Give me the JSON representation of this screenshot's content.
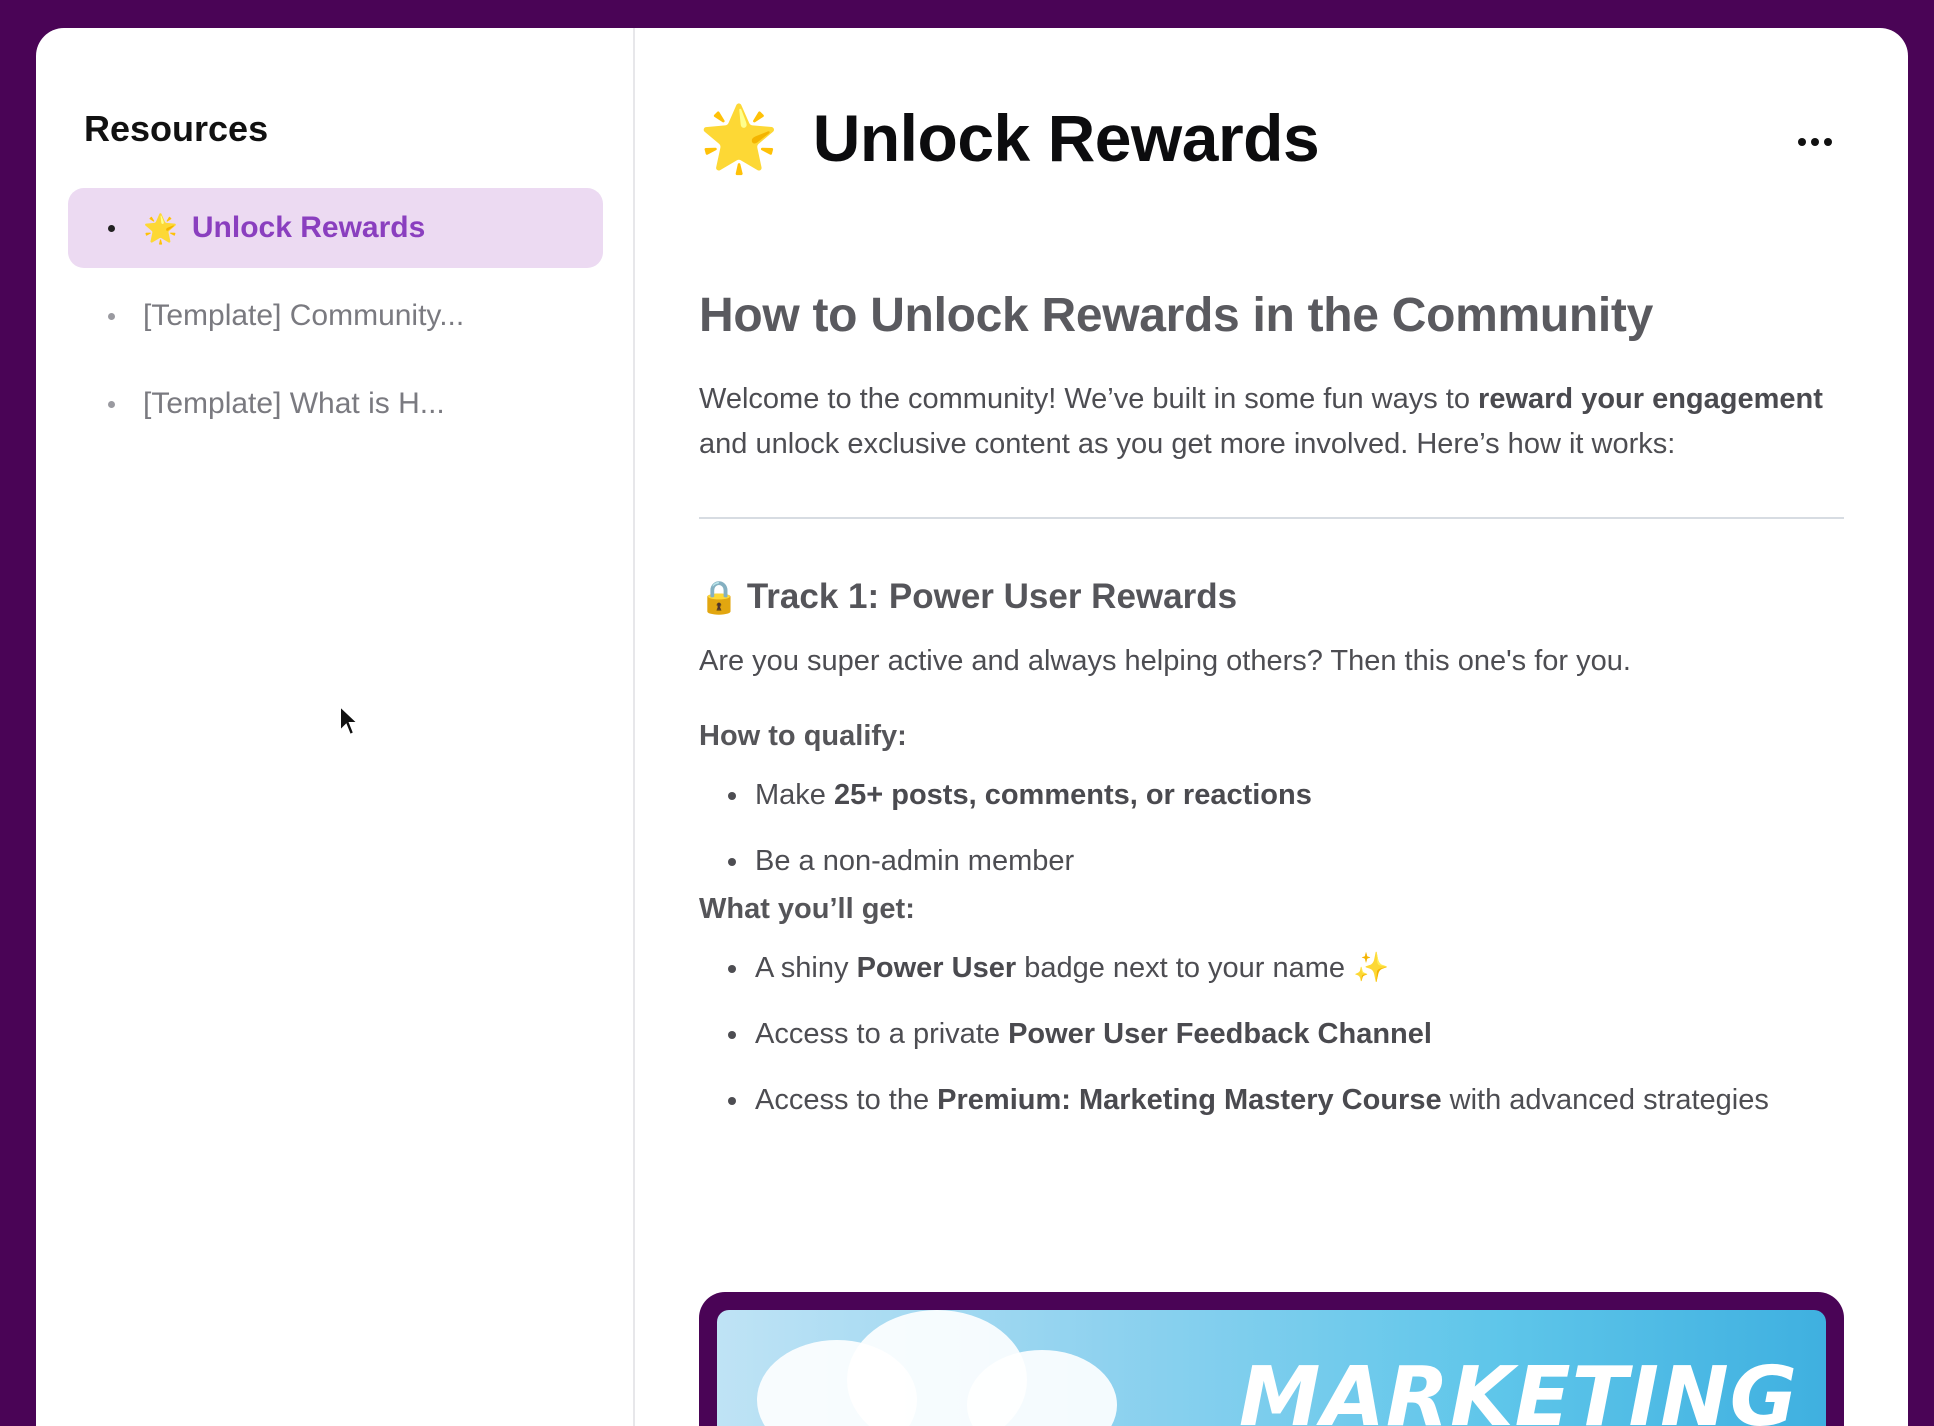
{
  "sidebar": {
    "title": "Resources",
    "items": [
      {
        "emoji": "🌟",
        "label": "Unlock Rewards",
        "active": true
      },
      {
        "emoji": "",
        "label": "[Template] Community...",
        "active": false
      },
      {
        "emoji": "",
        "label": "[Template] What is H...",
        "active": false
      }
    ]
  },
  "page": {
    "emoji": "🌟",
    "title": "Unlock Rewards",
    "more_icon": "more-horizontal-icon"
  },
  "content": {
    "heading": "How to Unlock Rewards in the Community",
    "intro": {
      "before": "Welcome to the community! We’ve built in some fun ways to ",
      "bold": "reward your engagement",
      "after": " and unlock exclusive content as you get more involved. Here’s how it works:"
    },
    "track": {
      "icon": "🔒",
      "title": "Track 1: Power User Rewards",
      "description": "Are you super active and always helping others? Then this one's for you.",
      "qualify_label": "How to qualify:",
      "qualify": [
        {
          "before": "Make ",
          "bold": "25+ posts, comments, or reactions",
          "after": ""
        },
        {
          "before": "Be a non-admin member",
          "bold": "",
          "after": ""
        }
      ],
      "get_label": "What you’ll get:",
      "get": [
        {
          "before": "A shiny ",
          "bold": "Power User",
          "after": " badge next to your name ",
          "spark": "✨"
        },
        {
          "before": "Access to a private ",
          "bold": "Power User Feedback Channel",
          "after": ""
        },
        {
          "before": "Access to the ",
          "bold": "Premium: Marketing Mastery Course",
          "after": " with advanced strategies"
        }
      ]
    },
    "banner": {
      "text": "MARKETING"
    }
  },
  "colors": {
    "frame": "#4a0456",
    "accent": "#8a3fbf",
    "active_bg": "#ecdaf2"
  }
}
